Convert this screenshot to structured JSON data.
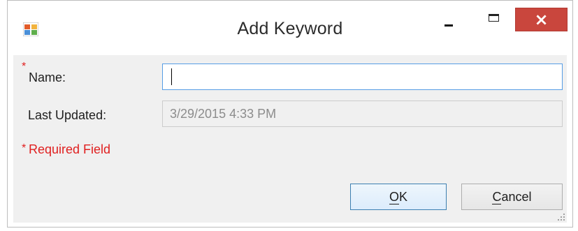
{
  "window": {
    "title": "Add Keyword",
    "controls": {
      "minimize": "minimize-icon",
      "maximize": "maximize-icon",
      "close": "×"
    }
  },
  "form": {
    "required_marker": "*",
    "name": {
      "label": "Name:",
      "value": ""
    },
    "last_updated": {
      "label": "Last Updated:",
      "value": "3/29/2015 4:33 PM"
    },
    "required_note": "Required Field"
  },
  "buttons": {
    "ok": {
      "mnemonic": "O",
      "rest": "K"
    },
    "cancel": {
      "mnemonic": "C",
      "rest": "ancel"
    }
  },
  "colors": {
    "required": "#e02020",
    "close_button": "#c9463d",
    "focus_border": "#569de5",
    "client_background": "#f0f0f0"
  }
}
